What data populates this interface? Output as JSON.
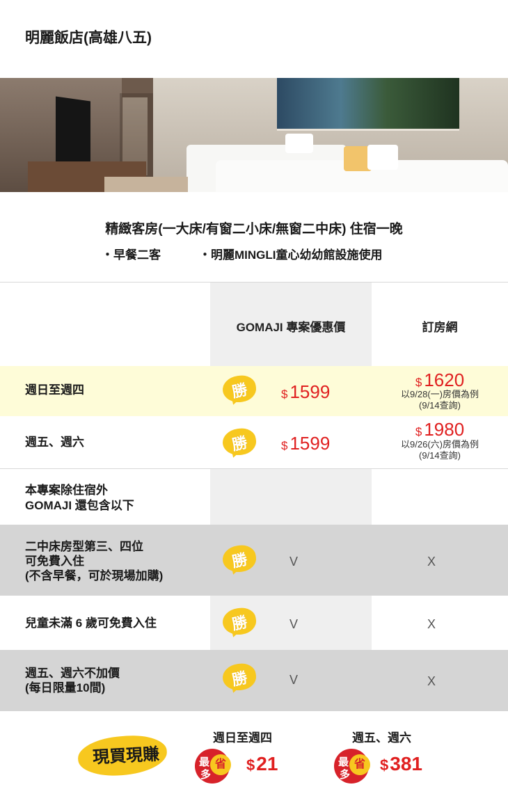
{
  "hotel": {
    "title": "明麗飯店(高雄八五)"
  },
  "offer": {
    "title": "精緻客房(一大床/有窗二小床/無窗二中床) 住宿一晚",
    "bullets": [
      "・早餐二客",
      "・明麗MINGLI童心幼幼館設施使用"
    ]
  },
  "table": {
    "col_gomaji": "GOMAJI 專案優惠價",
    "col_booking": "訂房網",
    "win_char": "勝",
    "price_rows": [
      {
        "label": "週日至週四",
        "currency": "$",
        "gomaji_price": "1599",
        "booking_price": "1620",
        "booking_note_1": "以9/28(一)房價為例",
        "booking_note_2": "(9/14查詢)"
      },
      {
        "label": "週五、週六",
        "currency": "$",
        "gomaji_price": "1599",
        "booking_price": "1980",
        "booking_note_1": "以9/26(六)房價為例",
        "booking_note_2": "(9/14查詢)"
      }
    ],
    "includes_header_1": "本專案除住宿外",
    "includes_header_2": "GOMAJI 還包含以下",
    "feature_rows": [
      {
        "label_1": "二中床房型第三、四位",
        "label_2": "可免費入住",
        "label_3": "(不含早餐，可於現場加購)",
        "gomaji": "V",
        "booking": "X"
      },
      {
        "label_1": "兒童未滿 6 歲可免費入住",
        "gomaji": "V",
        "booking": "X"
      },
      {
        "label_1": "週五、週六不加價",
        "label_2": "(每日限量10間)",
        "gomaji": "V",
        "booking": "X"
      }
    ]
  },
  "savings": {
    "banner": "現買現賺",
    "badge_most_1": "最",
    "badge_most_2": "多",
    "badge_save": "省",
    "currency": "$",
    "items": [
      {
        "label": "週日至週四",
        "amount": "21"
      },
      {
        "label": "週五、週六",
        "amount": "381"
      }
    ]
  },
  "colors": {
    "highlight_row": "#fefcd8",
    "gray_row": "#d5d5d5",
    "gomaji_column": "#efefef",
    "price_red": "#e02020",
    "badge_yellow": "#f7c81f",
    "badge_red": "#d7222a"
  },
  "icons": [
    "win-badge-icon",
    "save-badge-icon"
  ]
}
